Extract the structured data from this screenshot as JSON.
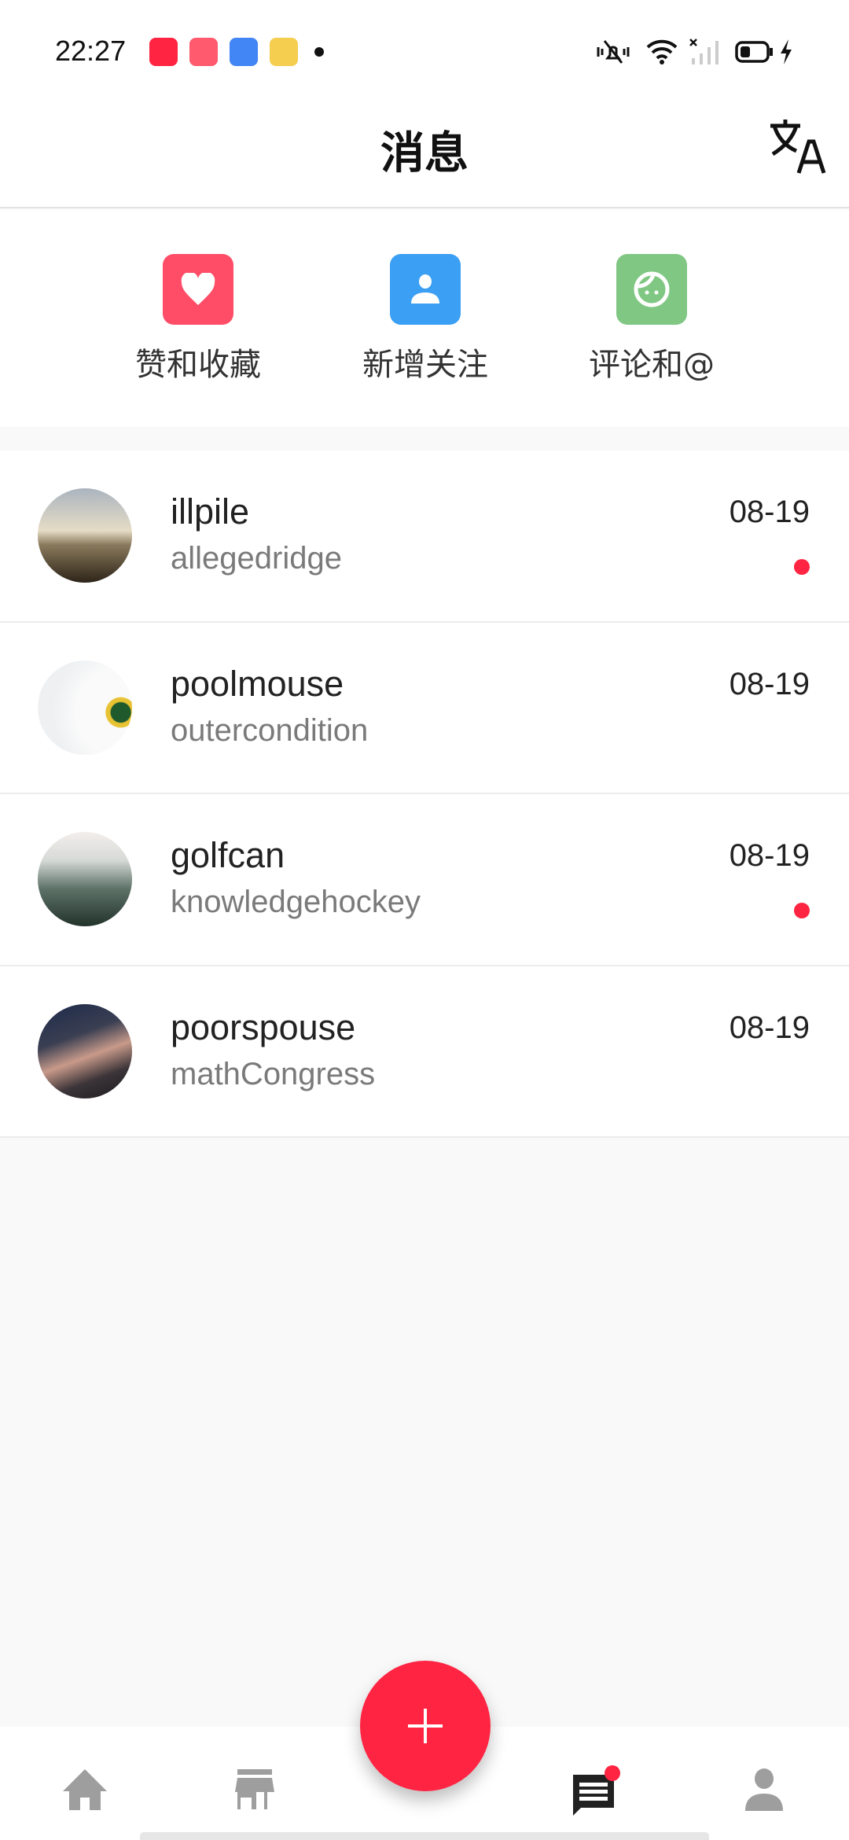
{
  "status_bar": {
    "time": "22:27",
    "app_icons": [
      "xiaohongshu-icon",
      "video-app-icon",
      "ship-app-icon",
      "diamond-app-icon"
    ],
    "system_icons": [
      "mute-vibrate-icon",
      "wifi-icon",
      "no-signal-icon",
      "battery-icon",
      "charging-icon"
    ]
  },
  "header": {
    "title": "消息",
    "translate_icon": "translate-icon"
  },
  "categories": [
    {
      "label": "赞和收藏",
      "icon": "heart-icon",
      "color": "#ff4d68"
    },
    {
      "label": "新增关注",
      "icon": "person-icon",
      "color": "#3b9ff3"
    },
    {
      "label": "评论和@",
      "icon": "face-icon",
      "color": "#80c784"
    }
  ],
  "messages": [
    {
      "name": "illpile",
      "subtitle": "allegedridge",
      "date": "08-19",
      "unread": true
    },
    {
      "name": "poolmouse",
      "subtitle": "outercondition",
      "date": "08-19",
      "unread": false
    },
    {
      "name": "golfcan",
      "subtitle": "knowledgehockey",
      "date": "08-19",
      "unread": true
    },
    {
      "name": "poorspouse",
      "subtitle": "mathCongress",
      "date": "08-19",
      "unread": false
    }
  ],
  "bottom_nav": {
    "items": [
      "home-icon",
      "store-icon",
      "add-icon",
      "messages-icon",
      "profile-icon"
    ],
    "active": "messages-icon",
    "accent": "#ff2442"
  }
}
